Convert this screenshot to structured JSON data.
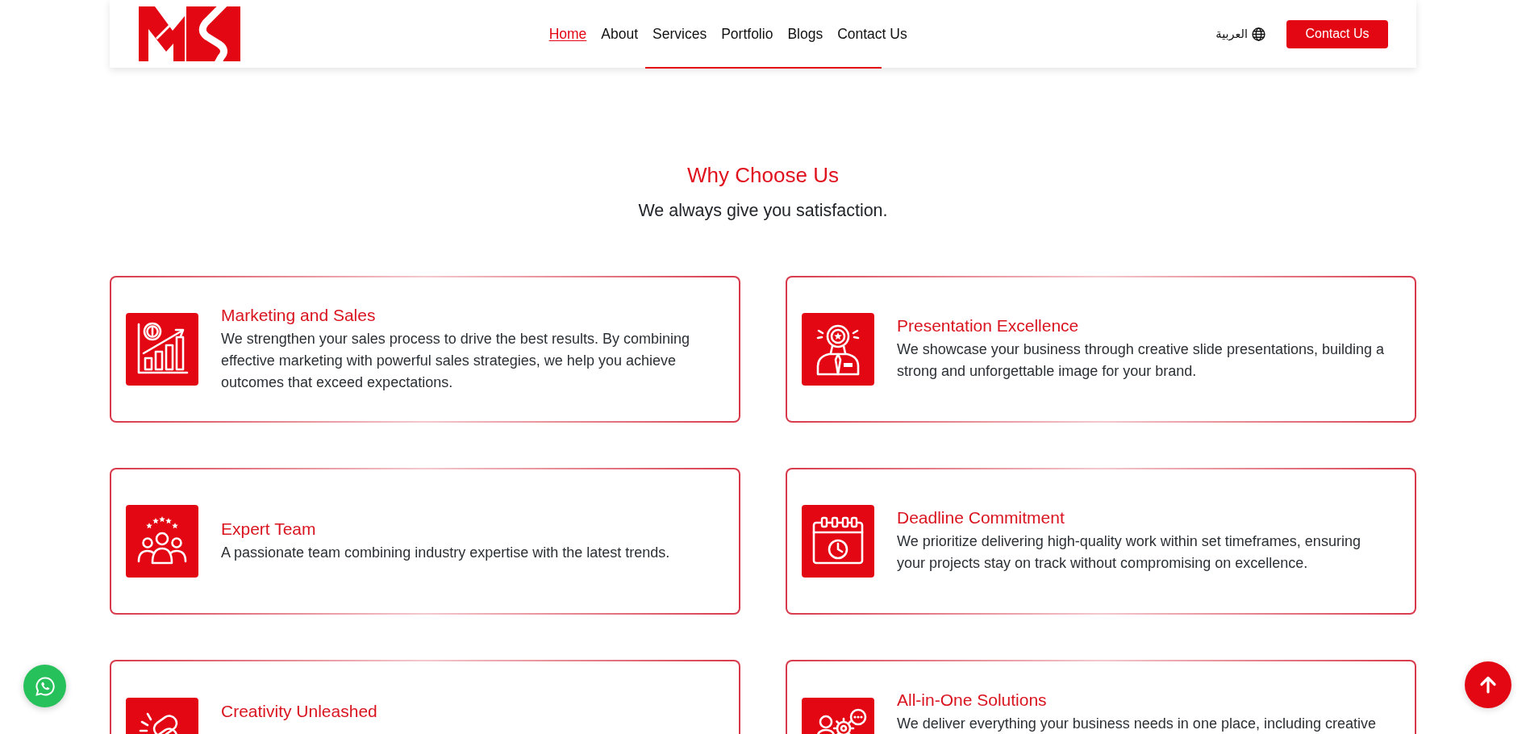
{
  "header": {
    "nav": [
      {
        "label": "Home",
        "selected": true
      },
      {
        "label": "About",
        "selected": false
      },
      {
        "label": "Services",
        "selected": false
      },
      {
        "label": "Portfolio",
        "selected": false
      },
      {
        "label": "Blogs",
        "selected": false
      },
      {
        "label": "Contact Us",
        "selected": false
      }
    ],
    "language": {
      "label": "العربية",
      "selected": false
    },
    "button": "Contact Us"
  },
  "section": {
    "title": "Why Choose Us",
    "subtitle": "We always give you satisfaction."
  },
  "features": [
    {
      "kind": "chart",
      "title": "Marketing and Sales",
      "body": "We strengthen your sales process to drive the best results. By combining effective marketing with powerful sales strategies, we help you achieve outcomes that exceed expectations."
    },
    {
      "kind": "award",
      "title": "Presentation Excellence",
      "body": "We showcase your business through creative slide presentations, building a strong and unforgettable image for your brand."
    },
    {
      "kind": "team",
      "title": "Expert Team",
      "body": "A passionate team combining industry expertise with the latest trends."
    },
    {
      "kind": "calendar",
      "title": "Deadline Commitment",
      "body": "We prioritize delivering high-quality work within set timeframes, ensuring your projects stay on track without compromising on excellence."
    },
    {
      "kind": "link",
      "title": "Creativity Unleashed"
    },
    {
      "kind": "gears",
      "title": "All-in-One Solutions",
      "body": "We deliver everything your business needs in one place, including creative"
    }
  ]
}
